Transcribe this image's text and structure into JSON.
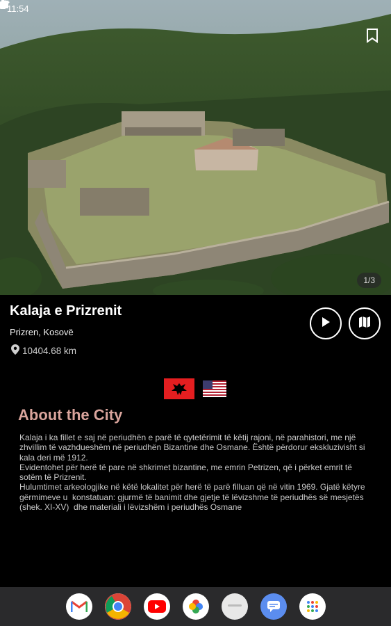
{
  "status_bar": {
    "time": "11:54"
  },
  "hero": {
    "page_indicator": "1/3"
  },
  "place": {
    "name": "Kalaja e Prizrenit",
    "location": "Prizren, Kosovë",
    "distance": "10404.68 km"
  },
  "about": {
    "title": "About the City",
    "text": "Kalaja i ka fillet e saj në periudhën e parë të qytetërimit të këtij rajoni, në parahistori, me një zhvillim të vazhdueshëm në periudhën Bizantine dhe Osmane. Është përdorur ekskluzivisht si kala deri më 1912.\nEvidentohet për herë të pare në shkrimet bizantine, me emrin Petrizen, që i përket emrit të sotëm të Prizrenit.\nHulumtimet arkeologjike në këtë lokalitet për herë të parë filluan që në vitin 1969. Gjatë këtyre gërmimeve u  konstatuan: gjurmë të banimit dhe gjetje të lëvizshme të periudhës së mesjetës (shek. XI-XV)  dhe materiali i lëvizshëm i periudhës Osmane"
  },
  "colors": {
    "accent": "#d9a49c",
    "albania_red": "#e41e20"
  },
  "dock": {
    "apps": [
      "gmail-icon",
      "chrome-icon",
      "youtube-icon",
      "photos-icon",
      "messages-icon",
      "chat-icon",
      "apps-grid-icon"
    ]
  }
}
